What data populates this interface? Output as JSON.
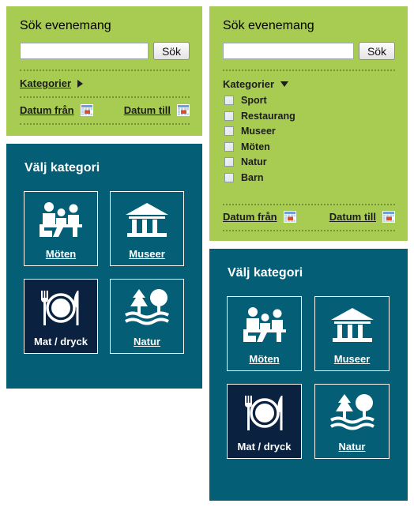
{
  "colors": {
    "green_panel": "#a8cc52",
    "teal_panel": "#035e76",
    "selected_tile": "#0a2240",
    "text_dark": "#1d1d1d",
    "text_light": "#ffffff",
    "dotted_rule": "#6f8a33",
    "calendar_accent": "#d94f2b"
  },
  "left_column": {
    "search_panel": {
      "title": "Sök evenemang",
      "input": {
        "value": "",
        "placeholder": ""
      },
      "search_button": "Sök",
      "categories": {
        "label": "Kategorier",
        "toggle_icon": "triangle-right-icon",
        "expanded": false
      },
      "date_from": {
        "label": "Datum från",
        "icon": "calendar-icon"
      },
      "date_to": {
        "label": "Datum till",
        "icon": "calendar-icon"
      }
    },
    "category_panel": {
      "title": "Välj kategori",
      "tiles": [
        {
          "label": "Möten",
          "icon": "meeting-icon",
          "selected": false
        },
        {
          "label": "Museer",
          "icon": "museum-icon",
          "selected": false
        },
        {
          "label": "Mat / dryck",
          "icon": "restaurant-icon",
          "selected": true
        },
        {
          "label": "Natur",
          "icon": "nature-icon",
          "selected": false
        }
      ]
    }
  },
  "right_column": {
    "search_panel": {
      "title": "Sök evenemang",
      "input": {
        "value": "",
        "placeholder": ""
      },
      "search_button": "Sök",
      "categories": {
        "label": "Kategorier",
        "toggle_icon": "triangle-down-icon",
        "expanded": true,
        "options": [
          {
            "label": "Sport",
            "checked": false
          },
          {
            "label": "Restaurang",
            "checked": false
          },
          {
            "label": "Museer",
            "checked": false
          },
          {
            "label": "Möten",
            "checked": false
          },
          {
            "label": "Natur",
            "checked": false
          },
          {
            "label": "Barn",
            "checked": false
          }
        ]
      },
      "date_from": {
        "label": "Datum från",
        "icon": "calendar-icon"
      },
      "date_to": {
        "label": "Datum till",
        "icon": "calendar-icon"
      }
    },
    "category_panel": {
      "title": "Välj kategori",
      "tiles": [
        {
          "label": "Möten",
          "icon": "meeting-icon",
          "selected": false
        },
        {
          "label": "Museer",
          "icon": "museum-icon",
          "selected": false
        },
        {
          "label": "Mat / dryck",
          "icon": "restaurant-icon",
          "selected": true
        },
        {
          "label": "Natur",
          "icon": "nature-icon",
          "selected": false
        }
      ]
    }
  }
}
